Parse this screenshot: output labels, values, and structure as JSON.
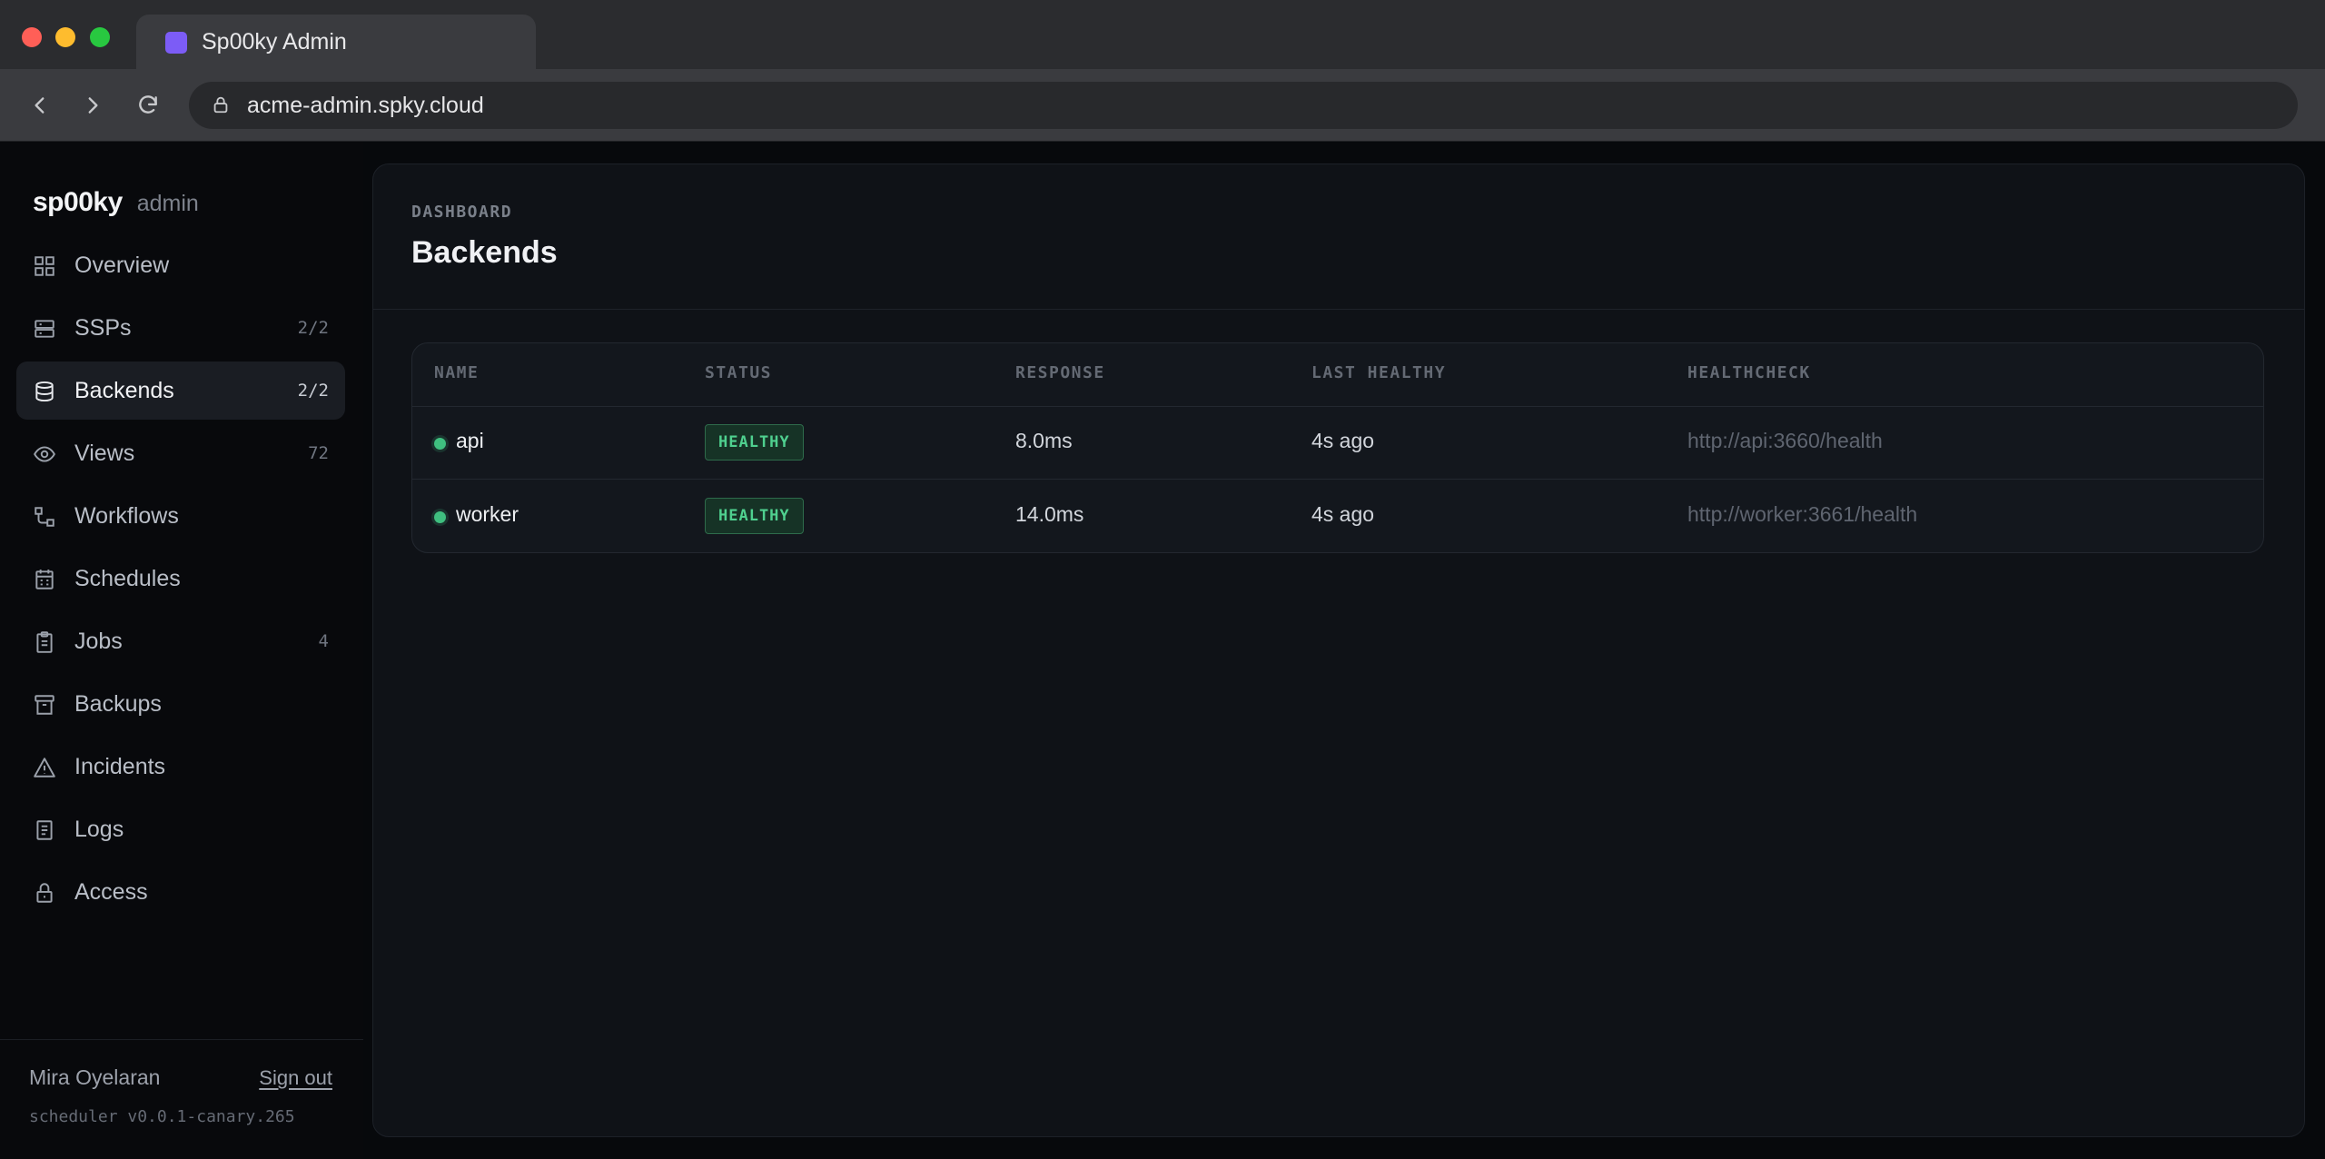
{
  "browser": {
    "tab_title": "Sp00ky Admin",
    "url": "acme-admin.spky.cloud"
  },
  "brand": {
    "logo": "sp00ky",
    "subtitle": "admin"
  },
  "sidebar": {
    "items": [
      {
        "label": "Overview",
        "count": "",
        "icon": "grid-icon"
      },
      {
        "label": "SSPs",
        "count": "2/2",
        "icon": "server-icon"
      },
      {
        "label": "Backends",
        "count": "2/2",
        "icon": "database-icon",
        "active": true
      },
      {
        "label": "Views",
        "count": "72",
        "icon": "eye-icon"
      },
      {
        "label": "Workflows",
        "count": "",
        "icon": "workflow-icon"
      },
      {
        "label": "Schedules",
        "count": "",
        "icon": "calendar-icon"
      },
      {
        "label": "Jobs",
        "count": "4",
        "icon": "clipboard-icon"
      },
      {
        "label": "Backups",
        "count": "",
        "icon": "archive-icon"
      },
      {
        "label": "Incidents",
        "count": "",
        "icon": "warning-icon"
      },
      {
        "label": "Logs",
        "count": "",
        "icon": "document-icon"
      },
      {
        "label": "Access",
        "count": "",
        "icon": "lock-icon"
      }
    ],
    "footer": {
      "user": "Mira Oyelaran",
      "signout": "Sign out",
      "version": "scheduler v0.0.1-canary.265"
    }
  },
  "main": {
    "eyebrow": "DASHBOARD",
    "title": "Backends",
    "table": {
      "headers": [
        "NAME",
        "STATUS",
        "RESPONSE",
        "LAST HEALTHY",
        "HEALTHCHECK"
      ],
      "rows": [
        {
          "name": "api",
          "status": "HEALTHY",
          "response": "8.0ms",
          "last_healthy": "4s ago",
          "healthcheck": "http://api:3660/health"
        },
        {
          "name": "worker",
          "status": "HEALTHY",
          "response": "14.0ms",
          "last_healthy": "4s ago",
          "healthcheck": "http://worker:3661/health"
        }
      ]
    }
  },
  "colors": {
    "accent_purple": "#7c5cf6",
    "healthy_green": "#4fd08f",
    "panel_bg": "#0f1217"
  }
}
